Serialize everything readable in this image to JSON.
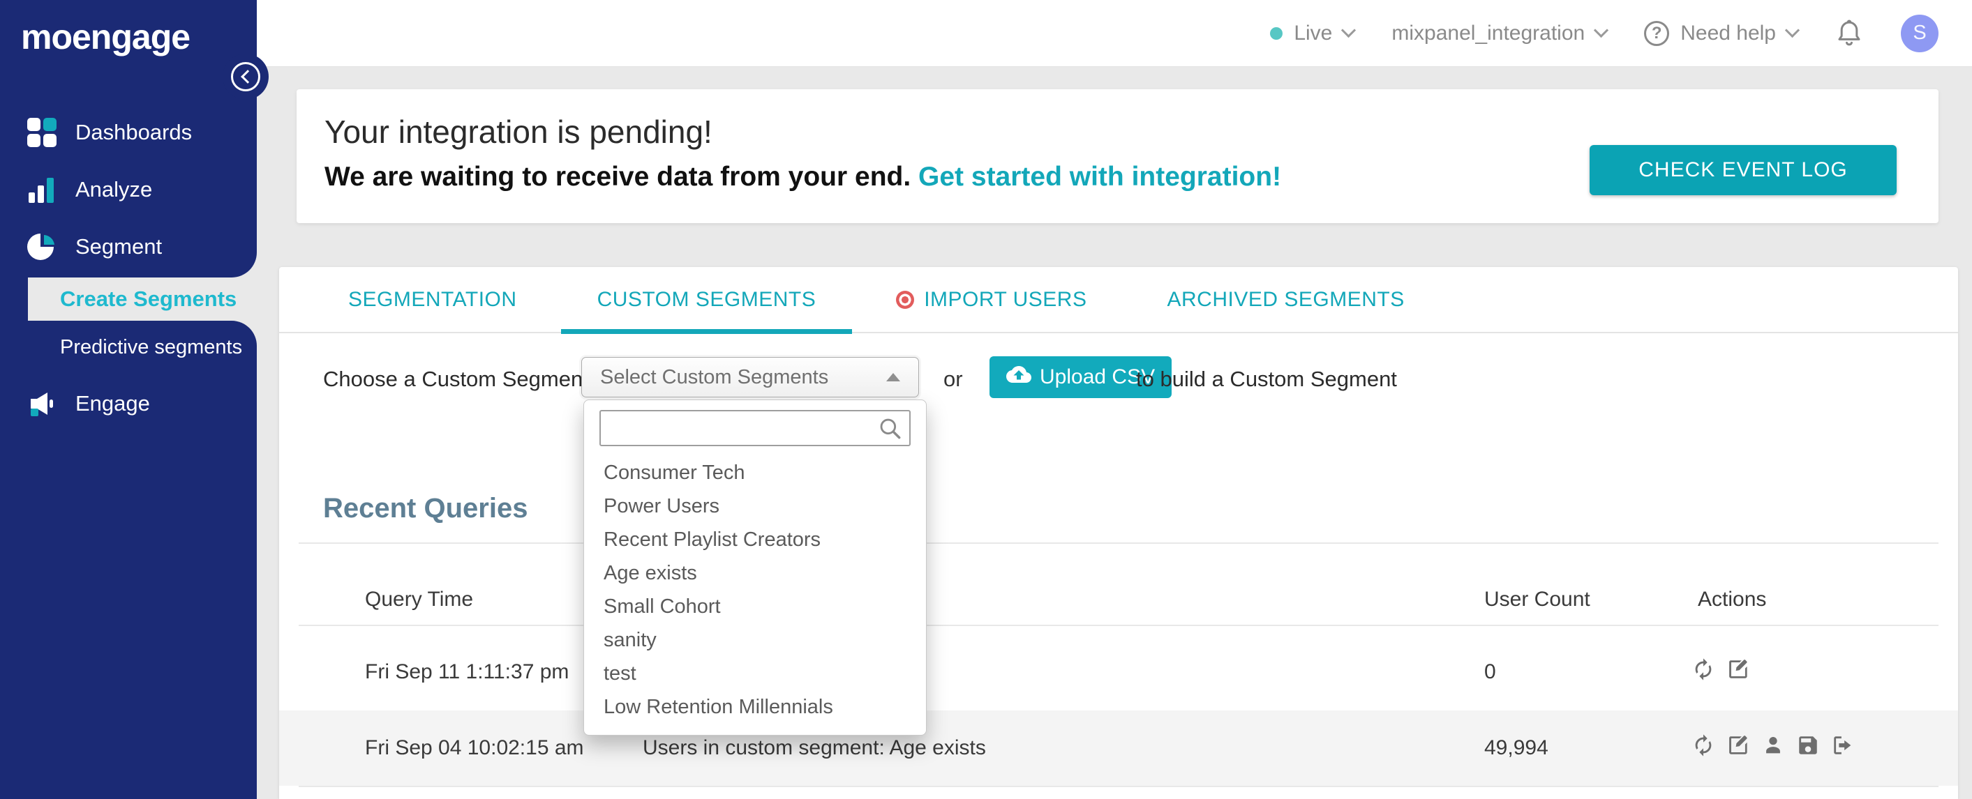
{
  "header": {
    "environment": "Live",
    "workspace": "mixpanel_integration",
    "help_label": "Need help",
    "avatar_initial": "S"
  },
  "sidebar": {
    "logo": "moengage",
    "items": [
      {
        "label": "Dashboards",
        "icon": "grid-icon"
      },
      {
        "label": "Analyze",
        "icon": "bar-chart-icon"
      },
      {
        "label": "Segment",
        "icon": "pie-chart-icon"
      },
      {
        "label": "Engage",
        "icon": "megaphone-icon"
      }
    ],
    "sub_items": [
      {
        "label": "Create Segments",
        "active": true
      },
      {
        "label": "Predictive segments",
        "active": false
      }
    ]
  },
  "banner": {
    "title": "Your integration is pending!",
    "subtitle": "We are waiting to receive data from your end.",
    "link_text": "Get started with integration!",
    "button_label": "CHECK EVENT LOG"
  },
  "tabs": [
    {
      "label": "SEGMENTATION",
      "active": false
    },
    {
      "label": "CUSTOM SEGMENTS",
      "active": true
    },
    {
      "label": "IMPORT USERS",
      "active": false,
      "icon": "target-dot-icon"
    },
    {
      "label": "ARCHIVED SEGMENTS",
      "active": false
    }
  ],
  "segment_picker": {
    "label": "Choose a Custom Segment:",
    "select_value": "Select Custom Segments",
    "search_placeholder": "",
    "options": [
      "Consumer Tech",
      "Power Users",
      "Recent Playlist Creators",
      "Age exists",
      "Small Cohort",
      "sanity",
      "test",
      "Low Retention Millennials"
    ],
    "or_text": "or",
    "upload_button": "Upload CSV",
    "suffix_text": "to build a Custom Segment",
    "icons": {
      "select_caret": "caret-up-icon",
      "search": "search-icon",
      "upload": "cloud-upload-icon"
    }
  },
  "recent_queries": {
    "title": "Recent Queries",
    "columns": [
      "Query Time",
      "User Count",
      "Actions"
    ],
    "rows": [
      {
        "query_time": "Fri Sep 11 1:11:37 pm",
        "query": "",
        "user_count": "0",
        "actions": [
          "refresh-icon",
          "edit-icon"
        ]
      },
      {
        "query_time": "Fri Sep 04 10:02:15 am",
        "query": "Users in custom segment: Age exists",
        "user_count": "49,994",
        "actions": [
          "refresh-icon",
          "edit-icon",
          "user-icon",
          "save-icon",
          "export-icon"
        ]
      }
    ]
  },
  "colors": {
    "sidebar_navy": "#1B2A75",
    "accent_teal": "#13A7B9",
    "button_teal": "#0BA3B4",
    "active_link_teal": "#1FB9CE",
    "import_red": "#E25C5C",
    "heading_slate": "#5E7F94",
    "avatar_bg": "#8E99F3",
    "live_dot": "#57C7C4",
    "page_bg": "#E9E9E9",
    "row_stripe": "#F4F4F4"
  }
}
